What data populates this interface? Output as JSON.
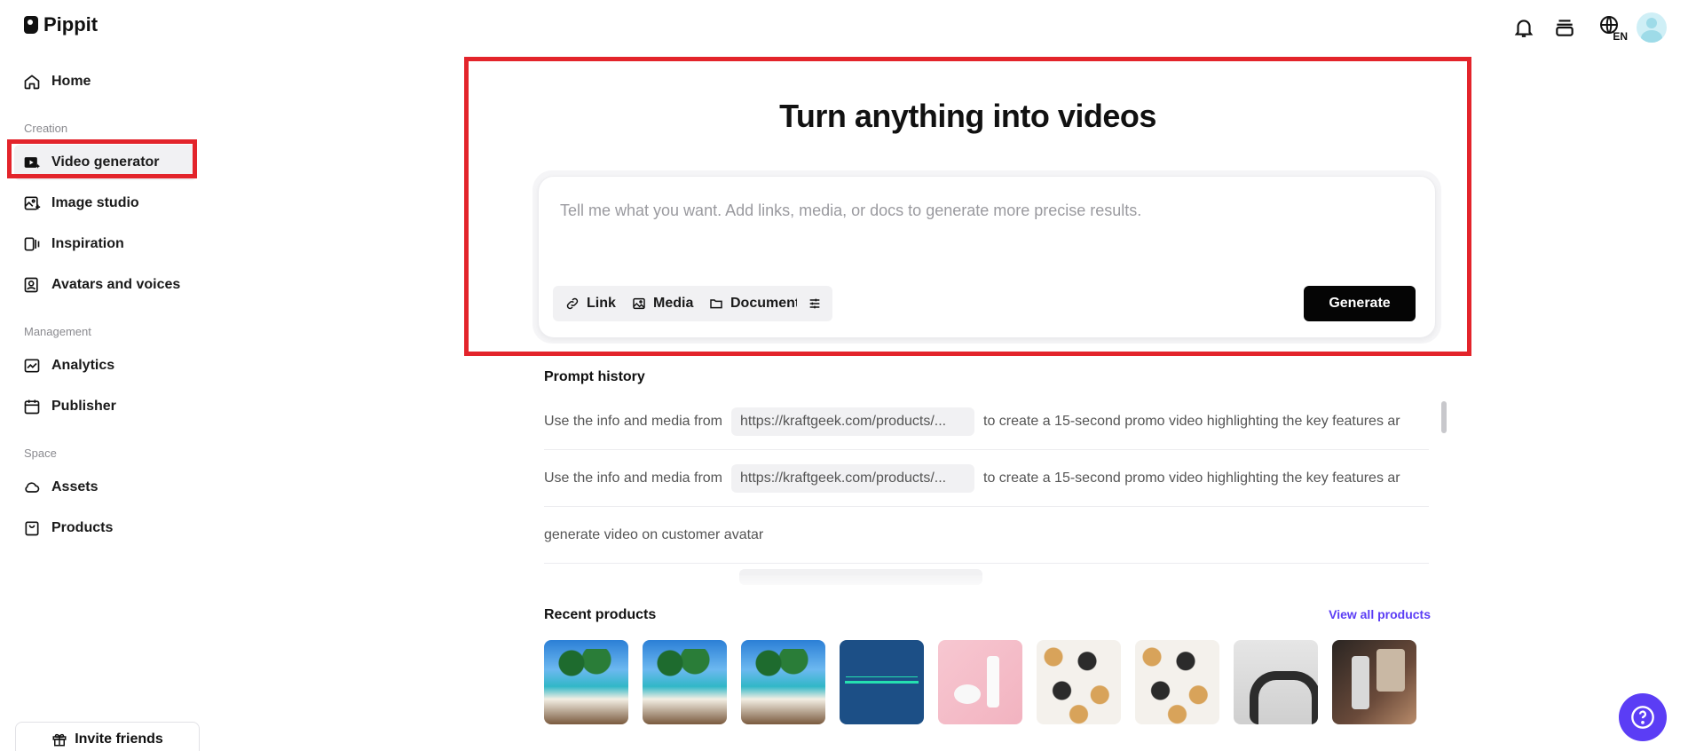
{
  "app": {
    "name": "Pippit"
  },
  "sidebar": {
    "home": "Home",
    "sections": {
      "creation": "Creation",
      "management": "Management",
      "space": "Space"
    },
    "items": {
      "video_generator": "Video generator",
      "image_studio": "Image studio",
      "inspiration": "Inspiration",
      "avatars_voices": "Avatars and voices",
      "analytics": "Analytics",
      "publisher": "Publisher",
      "assets": "Assets",
      "products": "Products"
    },
    "active_item": "Video generator",
    "invite": "Invite friends"
  },
  "header": {
    "language": "EN"
  },
  "hero": {
    "title": "Turn anything into videos",
    "prompt_placeholder": "Tell me what you want. Add links, media, or docs to generate more precise results.",
    "buttons": {
      "link": "Link",
      "media": "Media",
      "document": "Document",
      "generate": "Generate"
    }
  },
  "prompt_history": {
    "title": "Prompt history",
    "rows": [
      {
        "prefix": "Use the info and media from",
        "url": "https://kraftgeek.com/products/...",
        "suffix": "to create a 15-second promo video highlighting the key features ar"
      },
      {
        "prefix": "Use the info and media from",
        "url": "https://kraftgeek.com/products/...",
        "suffix": "to create a 15-second promo video highlighting the key features ar"
      },
      {
        "prefix": "generate video on customer avatar",
        "url": "",
        "suffix": ""
      }
    ]
  },
  "recent_products": {
    "title": "Recent products",
    "view_all": "View all products"
  },
  "colors": {
    "accent": "#5b3df5",
    "highlight": "#e3242b",
    "generate_bg": "#050505"
  }
}
